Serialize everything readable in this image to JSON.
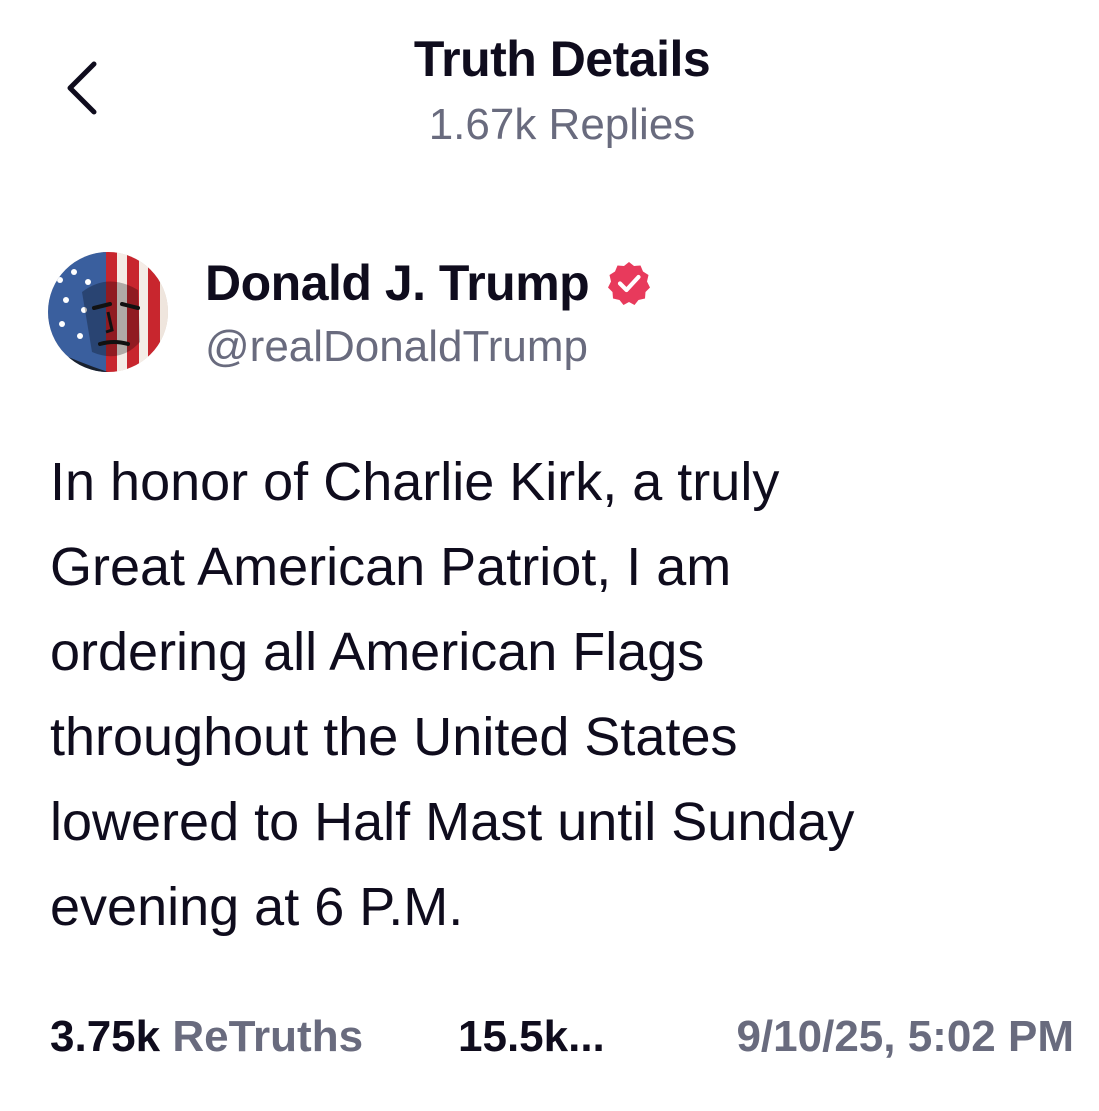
{
  "header": {
    "title": "Truth Details",
    "subtitle": "1.67k Replies",
    "back_icon": "chevron-left-icon"
  },
  "author": {
    "name": "Donald J. Trump",
    "handle": "@realDonaldTrump",
    "verified_icon": "verified-badge-icon",
    "verified_color": "#e83a5c",
    "avatar_description": "avatar"
  },
  "post": {
    "text": "In honor of Charlie Kirk, a truly\nGreat American Patriot, I am\nordering all American Flags\nthroughout the United States\nlowered to Half Mast until Sunday\nevening at 6 P.M."
  },
  "stats": {
    "retruths_count": "3.75k",
    "retruths_label": "ReTruths",
    "likes_count": "15.5k...",
    "timestamp": "9/10/25, 5:02 PM"
  },
  "colors": {
    "text_primary": "#0f0c1d",
    "text_secondary": "#696b7e",
    "background": "#ffffff"
  }
}
